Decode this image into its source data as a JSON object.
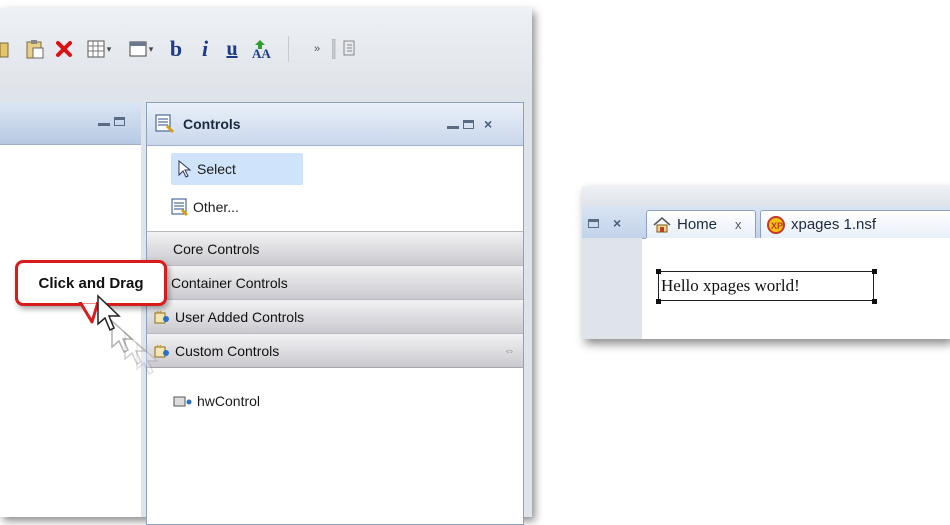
{
  "toolbar": {
    "icons": [
      "paste-icon",
      "delete-icon",
      "table-icon",
      "panel-icon",
      "bold-icon",
      "italic-icon",
      "underline-icon",
      "font-size-icon",
      "overflow-icon",
      "view-icon"
    ],
    "bold_glyph": "b",
    "italic_glyph": "i",
    "underline_glyph": "u"
  },
  "controls_panel": {
    "title": "Controls",
    "select_label": "Select",
    "other_label": "Other...",
    "sections": [
      {
        "label": "Core Controls"
      },
      {
        "label": "Container Controls"
      },
      {
        "label": "User Added Controls"
      },
      {
        "label": "Custom Controls"
      }
    ],
    "custom_item_label": "hwControl"
  },
  "callout": {
    "text": "Click and Drag"
  },
  "preview": {
    "tabs": [
      {
        "label": "Home",
        "close": "x"
      },
      {
        "label": "xpages 1.nsf"
      }
    ],
    "design_text": "Hello xpages world!"
  },
  "colors": {
    "callout_border": "#d81c1c",
    "selection_bg": "#cfe3fb",
    "panel_header": "#c9d7ec"
  }
}
